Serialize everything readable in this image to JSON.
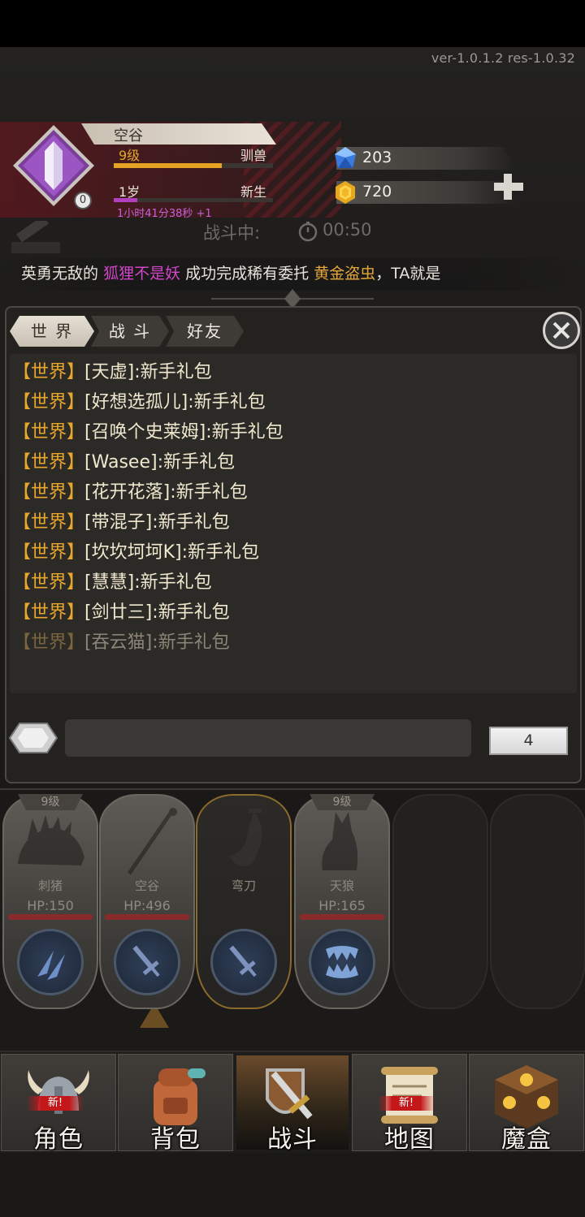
{
  "version": "ver-1.0.1.2  res-1.0.32",
  "player": {
    "name": "空谷",
    "level": "9级",
    "class": "驯兽",
    "exp_progress": 0.68,
    "age": "1岁",
    "status": "新生",
    "age_progress": 0.15,
    "timer": "1小时41分38秒 +1",
    "badge": "0"
  },
  "currency": {
    "gems": "203",
    "gold": "720"
  },
  "battle": {
    "status": "战斗中:",
    "timer": "00:50"
  },
  "marquee": {
    "prefix": "英勇无敌的",
    "player": "狐狸不是妖",
    "action": "成功完成稀有委托",
    "target": "黄金盗虫",
    "suffix": "，TA就是"
  },
  "chat": {
    "tabs": [
      "世 界",
      "战 斗",
      "好友"
    ],
    "active_tab": 0,
    "messages": [
      {
        "channel": "世界",
        "text": "[天虚]:新手礼包"
      },
      {
        "channel": "世界",
        "text": "[好想选孤儿]:新手礼包"
      },
      {
        "channel": "世界",
        "text": "[召唤个史莱姆]:新手礼包"
      },
      {
        "channel": "世界",
        "text": "[Wasee]:新手礼包"
      },
      {
        "channel": "世界",
        "text": "[花开花落]:新手礼包"
      },
      {
        "channel": "世界",
        "text": "[带混子]:新手礼包"
      },
      {
        "channel": "世界",
        "text": "[坎坎坷坷K]:新手礼包"
      },
      {
        "channel": "世界",
        "text": "[慧慧]:新手礼包"
      },
      {
        "channel": "世界",
        "text": "[剑廿三]:新手礼包"
      },
      {
        "channel": "世界",
        "text": "[吞云猫]:新手礼包"
      }
    ],
    "input_value": "",
    "send_count": "4"
  },
  "party": [
    {
      "level": "9级",
      "name": "刺猪",
      "hp": "HP:150",
      "skill_icon": "claw-slash-icon",
      "art_icon": "hedgehog-icon"
    },
    {
      "level": "",
      "name": "空谷",
      "hp": "HP:496",
      "skill_icon": "sword-icon",
      "art_icon": "staff-icon"
    },
    {
      "level": "",
      "name": "弯刀",
      "hp": "",
      "skill_icon": "sword-icon",
      "art_icon": "scimitar-icon"
    },
    {
      "level": "9级",
      "name": "天狼",
      "hp": "HP:165",
      "skill_icon": "fangs-icon",
      "art_icon": "wolf-icon"
    },
    {
      "empty": true
    },
    {
      "empty": true
    }
  ],
  "nav": [
    {
      "label": "角色",
      "icon": "viking-helmet-icon",
      "new": "新!"
    },
    {
      "label": "背包",
      "icon": "backpack-icon",
      "new": ""
    },
    {
      "label": "战斗",
      "icon": "sword-shield-icon",
      "new": ""
    },
    {
      "label": "地图",
      "icon": "scroll-map-icon",
      "new": "新!"
    },
    {
      "label": "魔盒",
      "icon": "magic-box-icon",
      "new": ""
    }
  ],
  "colors": {
    "gold": "#e8a62c",
    "purple": "#d246c8",
    "chat_text": "#efe8cf"
  }
}
